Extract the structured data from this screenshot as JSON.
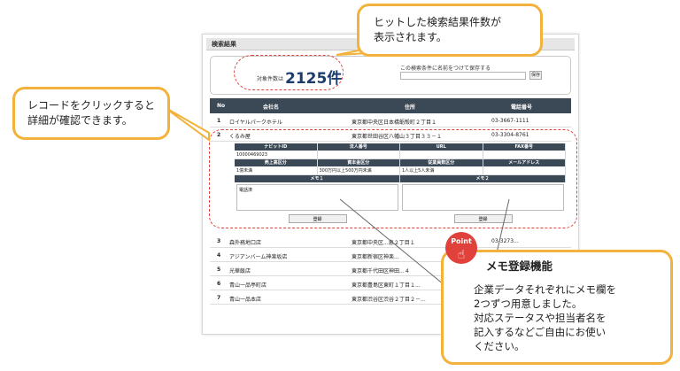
{
  "panel": {
    "title": "検索結果",
    "count_label": "対象件数は",
    "count_value": "2125件",
    "save_label": "この検索条件に名前をつけて保存する",
    "save_button": "保存"
  },
  "table": {
    "headers": [
      "No",
      "会社名",
      "住所",
      "電話番号"
    ],
    "rows": [
      {
        "no": "1",
        "name": "ロイヤルパークホテル",
        "addr": "東京都中央区日本橋蛎殻町２丁目１",
        "tel": "03-3667-1111"
      },
      {
        "no": "2",
        "name": "くるみ屋",
        "addr": "東京都世田谷区八幡山３丁目３３－１",
        "tel": "03-3304-8761"
      },
      {
        "no": "3",
        "name": "森外務地口店",
        "addr": "東京都中央区...恵２丁目１",
        "tel": "03-3273..."
      },
      {
        "no": "4",
        "name": "アジアンバーム神楽坂店",
        "addr": "東京都新宿区神楽...",
        "tel": ""
      },
      {
        "no": "5",
        "name": "光華飯店",
        "addr": "東京都千代田区神田...４",
        "tel": ""
      },
      {
        "no": "6",
        "name": "青山一品亭町店",
        "addr": "東京都豊島区東町１丁目１...",
        "tel": ""
      },
      {
        "no": "7",
        "name": "青山一品本店",
        "addr": "東京都渋谷区渋谷２丁目２－...",
        "tel": ""
      }
    ]
  },
  "detail": {
    "head1": [
      "ナビットID",
      "法人番号",
      "URL",
      "FAX番号"
    ],
    "val1": [
      "10000469023",
      "",
      "",
      ""
    ],
    "head2": [
      "売上高区分",
      "資本金区分",
      "従業員数区分",
      "メールアドレス"
    ],
    "val2": [
      "1億未満",
      "300万円以上500万円未満",
      "1人以上5人未満",
      ""
    ],
    "memo1_label": "メモ１",
    "memo2_label": "メモ２",
    "memo1_text": "電話済",
    "memo_button": "登録"
  },
  "callouts": {
    "hits_line1": "ヒットした検索結果件数が",
    "hits_line2": "表示されます。",
    "record_line1": "レコードをクリックすると",
    "record_line2": "詳細が確認できます。",
    "point_badge": "Point",
    "memo_title": "メモ登録機能",
    "memo_line1": "企業データそれぞれにメモ欄を",
    "memo_line2": "2つずつ用意しました。",
    "memo_line3": "対応ステータスや担当者名を",
    "memo_line4": "記入するなどご自由にお使い",
    "memo_line5": "ください。"
  },
  "colors": {
    "accent": "#f2b23b",
    "dash": "#e0413b",
    "table_head": "#3b4856",
    "count": "#1b3d6b"
  }
}
